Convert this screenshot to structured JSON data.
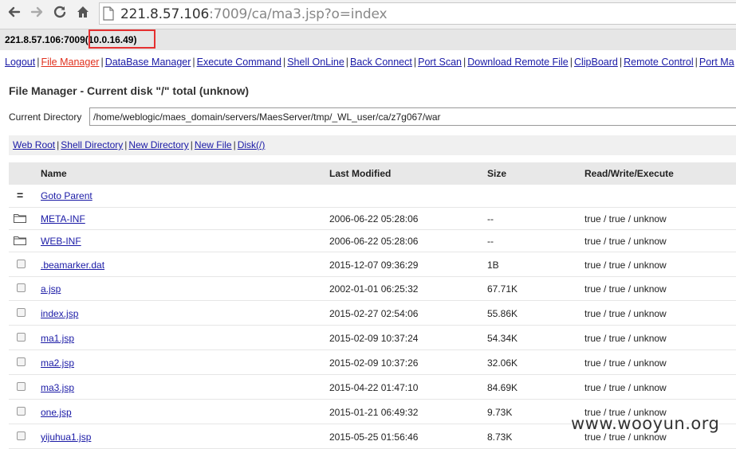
{
  "browser": {
    "url_host": "221.8.57.106",
    "url_rest": ":7009/ca/ma3.jsp?o=index"
  },
  "hostbar": {
    "host": "221.8.57.106:7009",
    "ip": "(10.0.16.49)"
  },
  "menu": [
    {
      "label": "Logout"
    },
    {
      "label": "File Manager",
      "active": true
    },
    {
      "label": "DataBase Manager"
    },
    {
      "label": "Execute Command"
    },
    {
      "label": "Shell OnLine"
    },
    {
      "label": "Back Connect"
    },
    {
      "label": "Port Scan"
    },
    {
      "label": "Download Remote File"
    },
    {
      "label": "ClipBoard"
    },
    {
      "label": "Remote Control"
    },
    {
      "label": "Port Ma"
    }
  ],
  "file_manager": {
    "title": "File Manager - Current disk \"/\" total (unknow)",
    "current_dir_label": "Current Directory",
    "current_dir_value": "/home/weblogic/maes_domain/servers/MaesServer/tmp/_WL_user/ca/z7g067/war",
    "quick_links": [
      "Web Root",
      "Shell Directory",
      "New Directory",
      "New File",
      "Disk(/)"
    ],
    "columns": {
      "name": "Name",
      "modified": "Last Modified",
      "size": "Size",
      "perm": "Read/Write/Execute"
    },
    "goto_parent": "Goto Parent",
    "rows": [
      {
        "type": "folder",
        "name": "META-INF",
        "modified": "2006-06-22 05:28:06",
        "size": "--",
        "perm": "true / true / unknow"
      },
      {
        "type": "folder",
        "name": "WEB-INF",
        "modified": "2006-06-22 05:28:06",
        "size": "--",
        "perm": "true / true / unknow"
      },
      {
        "type": "file",
        "name": ".beamarker.dat",
        "modified": "2015-12-07 09:36:29",
        "size": "1B",
        "perm": "true / true / unknow"
      },
      {
        "type": "file",
        "name": "a.jsp",
        "modified": "2002-01-01 06:25:32",
        "size": "67.71K",
        "perm": "true / true / unknow"
      },
      {
        "type": "file",
        "name": "index.jsp",
        "modified": "2015-02-27 02:54:06",
        "size": "55.86K",
        "perm": "true / true / unknow"
      },
      {
        "type": "file",
        "name": "ma1.jsp",
        "modified": "2015-02-09 10:37:24",
        "size": "54.34K",
        "perm": "true / true / unknow"
      },
      {
        "type": "file",
        "name": "ma2.jsp",
        "modified": "2015-02-09 10:37:26",
        "size": "32.06K",
        "perm": "true / true / unknow"
      },
      {
        "type": "file",
        "name": "ma3.jsp",
        "modified": "2015-04-22 01:47:10",
        "size": "84.69K",
        "perm": "true / true / unknow"
      },
      {
        "type": "file",
        "name": "one.jsp",
        "modified": "2015-01-21 06:49:32",
        "size": "9.73K",
        "perm": "true / true / unknow"
      },
      {
        "type": "file",
        "name": "yijuhua1.jsp",
        "modified": "2015-05-25 01:56:46",
        "size": "8.73K",
        "perm": "true / true / unknow"
      }
    ]
  },
  "watermark": "www.wooyun.org"
}
